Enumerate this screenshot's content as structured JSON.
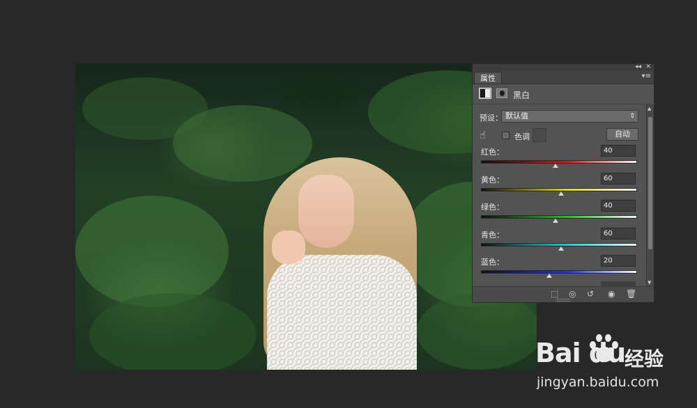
{
  "panel": {
    "top_controls": {
      "collapse": "◂◂",
      "close": "✕"
    },
    "tab_label": "属性",
    "menu_glyph": "▾≡",
    "title": "黑白",
    "preset_label": "预设：",
    "preset_value": "默认值",
    "tint_label": "色调",
    "auto_label": "自动",
    "sliders": [
      {
        "label": "红色：",
        "value": 40,
        "track_color": "#d01818"
      },
      {
        "label": "黄色：",
        "value": 60,
        "track_color": "#e0d418"
      },
      {
        "label": "绿色：",
        "value": 40,
        "track_color": "#22c022"
      },
      {
        "label": "青色：",
        "value": 60,
        "track_color": "#18d0d0"
      },
      {
        "label": "蓝色：",
        "value": 20,
        "track_color": "#2030e0"
      }
    ],
    "slider_range": [
      -200,
      300
    ]
  },
  "watermark": {
    "logo": "Bai  du",
    "jingyan": "经验",
    "url": "jingyan.baidu.com"
  },
  "colors": {
    "workspace": "#282828",
    "panel_bg": "#535353",
    "accent_text": "#e6e6e6"
  }
}
